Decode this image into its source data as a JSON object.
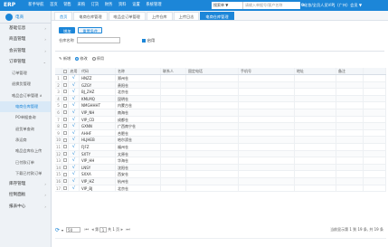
{
  "app": {
    "logo": "ERP",
    "top_nav": [
      "新手导航",
      "首页",
      "销售",
      "采购",
      "订货",
      "财务",
      "资料",
      "设置",
      "系统管理"
    ],
    "search_select": "搜索单 ▼",
    "search_placeholder": "请输入单据号/客户名称",
    "user": "化妆/全员人员VIPJ（广州）会员 ▼"
  },
  "sidebar": {
    "home": "电商",
    "items": [
      {
        "label": "基础信息",
        "expanded": false
      },
      {
        "label": "商品管理",
        "expanded": false
      },
      {
        "label": "会员管理",
        "expanded": false
      },
      {
        "label": "订单管理",
        "expanded": true
      }
    ],
    "order_subs": [
      {
        "label": "订单管理"
      },
      {
        "label": "退换货管理",
        "chev": true
      },
      {
        "label": "唯品会订单管理 ∧"
      }
    ],
    "vip_subs": [
      "电商仓库管理",
      "PO单据查询",
      "退货单查询",
      "承运商",
      "唯品会库存上传",
      "已付款订单",
      "下载已付款订单"
    ],
    "tail": [
      {
        "label": "库存管理"
      },
      {
        "label": "控制面板"
      },
      {
        "label": "报表中心"
      }
    ]
  },
  "tabs": [
    "首页",
    "电商仓库管理",
    "唯品会订单管理",
    "上传仓库",
    "上传日志",
    "电商仓库管理"
  ],
  "toolbar": {
    "query": "增加",
    "reset": "重置条件"
  },
  "filter": {
    "label": "仓库名称",
    "checkbox": "启用"
  },
  "options": {
    "a": "新增",
    "b": "修改",
    "c": "停用"
  },
  "table": {
    "headers": [
      "",
      "",
      "启用",
      "代码",
      "名称",
      "联系人",
      "固定电话",
      "手机号",
      "地址",
      "备注"
    ],
    "rows": [
      {
        "code": "HNZZ",
        "name": "郑州仓"
      },
      {
        "code": "GZGY",
        "name": "贵阳仓"
      },
      {
        "code": "BJ_ZHZ",
        "name": "北京仓"
      },
      {
        "code": "KMLMQ",
        "name": "昆明仓"
      },
      {
        "code": "NMGHHHT",
        "name": "内蒙古仓"
      },
      {
        "code": "VIP_NH",
        "name": "南海仓"
      },
      {
        "code": "VIP_CD",
        "name": "成都仓"
      },
      {
        "code": "GXNN",
        "name": "广西南宁仓"
      },
      {
        "code": "AHHF",
        "name": "合肥仓"
      },
      {
        "code": "HLJHEB",
        "name": "哈尔滨仓"
      },
      {
        "code": "FJFZ",
        "name": "福州仓"
      },
      {
        "code": "SXTY",
        "name": "太原仓"
      },
      {
        "code": "VIP_HH",
        "name": "华海仓"
      },
      {
        "code": "LNSY",
        "name": "沈阳仓"
      },
      {
        "code": "SXXA",
        "name": "西安仓"
      },
      {
        "code": "VIP_HZ",
        "name": "杭州仓"
      },
      {
        "code": "VIP_BJ",
        "name": "北京仓"
      }
    ]
  },
  "pager": {
    "page_size": "50",
    "page_label_pre": "第",
    "page": "1",
    "page_label_post": "共 1 页",
    "info": "当前显示第 1 到 19 条, 共 19 条"
  }
}
